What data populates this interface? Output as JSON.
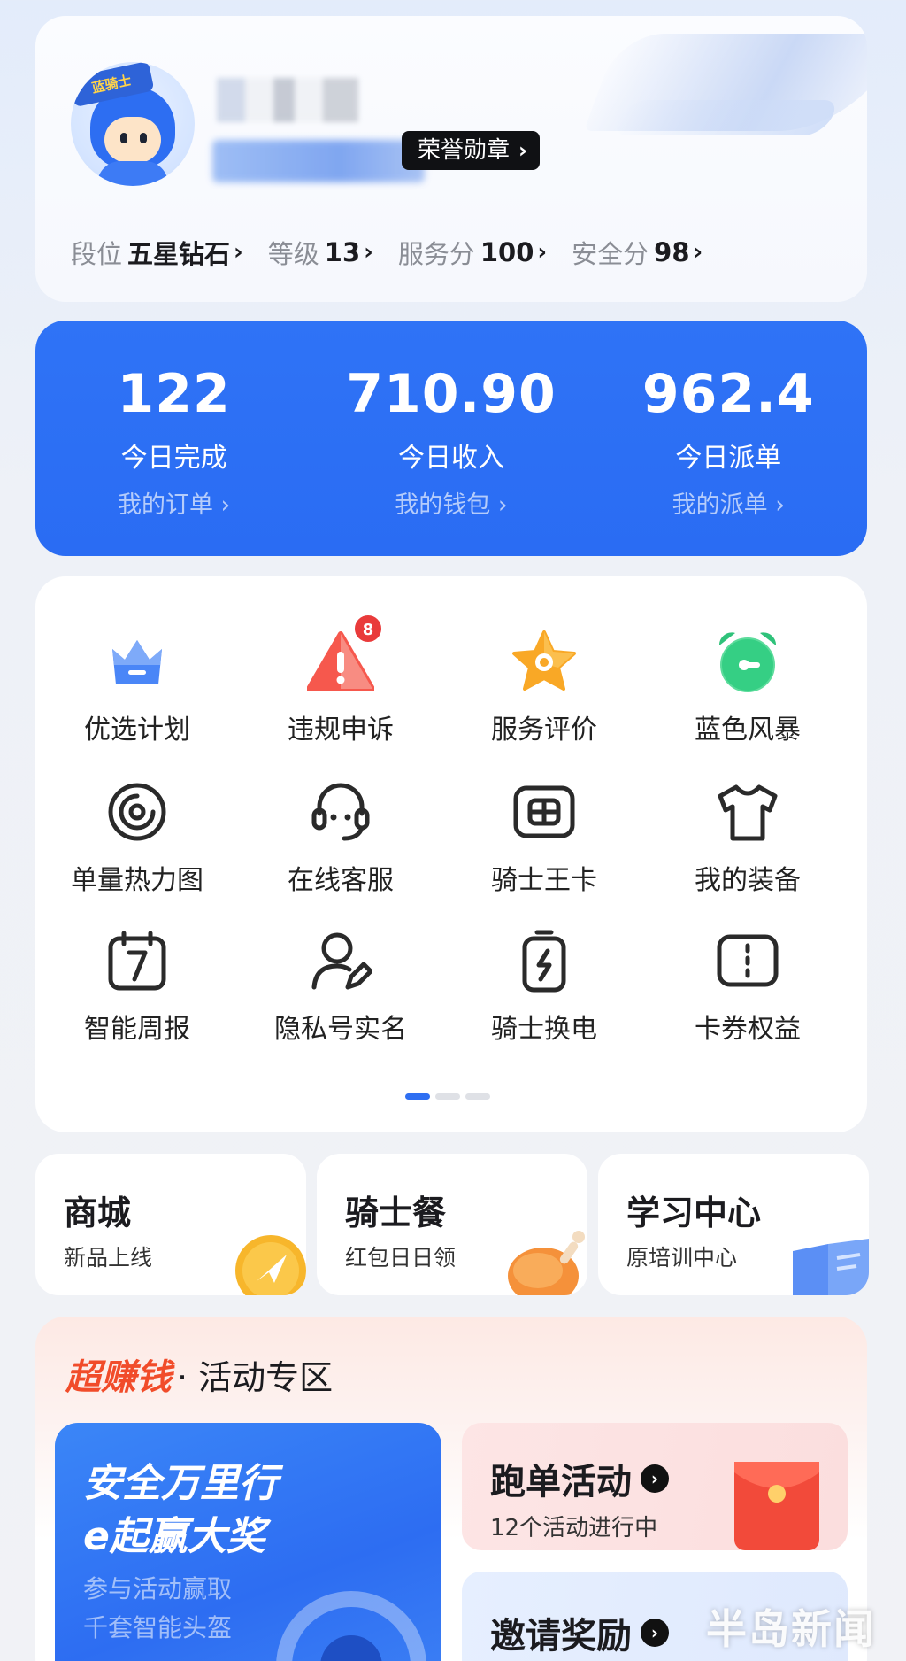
{
  "profile": {
    "avatar_tag": "蓝骑士",
    "honor_label": "荣誉勋章",
    "stats": [
      {
        "label": "段位",
        "value": "五星钻石"
      },
      {
        "label": "等级",
        "value": "13"
      },
      {
        "label": "服务分",
        "value": "100"
      },
      {
        "label": "安全分",
        "value": "98"
      }
    ]
  },
  "summary": [
    {
      "value": "122",
      "label": "今日完成",
      "link": "我的订单 ›"
    },
    {
      "value": "710.90",
      "label": "今日收入",
      "link": "我的钱包 ›"
    },
    {
      "value": "962.4",
      "label": "今日派单",
      "link": "我的派单 ›"
    }
  ],
  "grid": {
    "items": [
      {
        "label": "优选计划",
        "icon": "crown-icon"
      },
      {
        "label": "违规申诉",
        "icon": "warning-icon",
        "badge": "8"
      },
      {
        "label": "服务评价",
        "icon": "star-icon"
      },
      {
        "label": "蓝色风暴",
        "icon": "alarm-clock-icon"
      },
      {
        "label": "单量热力图",
        "icon": "target-icon"
      },
      {
        "label": "在线客服",
        "icon": "headset-icon"
      },
      {
        "label": "骑士王卡",
        "icon": "sim-card-icon"
      },
      {
        "label": "我的装备",
        "icon": "tshirt-icon"
      },
      {
        "label": "智能周报",
        "icon": "calendar-icon"
      },
      {
        "label": "隐私号实名",
        "icon": "user-edit-icon"
      },
      {
        "label": "骑士换电",
        "icon": "battery-icon"
      },
      {
        "label": "卡券权益",
        "icon": "coupon-icon"
      }
    ],
    "page_index": 0,
    "page_count": 3
  },
  "tiles": [
    {
      "title": "商城",
      "sub": "新品上线"
    },
    {
      "title": "骑士餐",
      "sub": "红包日日领"
    },
    {
      "title": "学习中心",
      "sub": "原培训中心"
    }
  ],
  "activity": {
    "brand": "超赚钱",
    "title": "· 活动专区",
    "banner": {
      "line1": "安全万里行",
      "line2": "e起赢大奖",
      "sub1": "参与活动赢取",
      "sub2": "千套智能头盔"
    },
    "run": {
      "title": "跑单活动",
      "sub": "12个活动进行中"
    },
    "invite": {
      "title": "邀请奖励"
    },
    "watermark": "半岛新闻"
  },
  "colors": {
    "primary": "#2f73f6",
    "badge": "#e93b3b",
    "brand_red": "#f14c2a"
  }
}
